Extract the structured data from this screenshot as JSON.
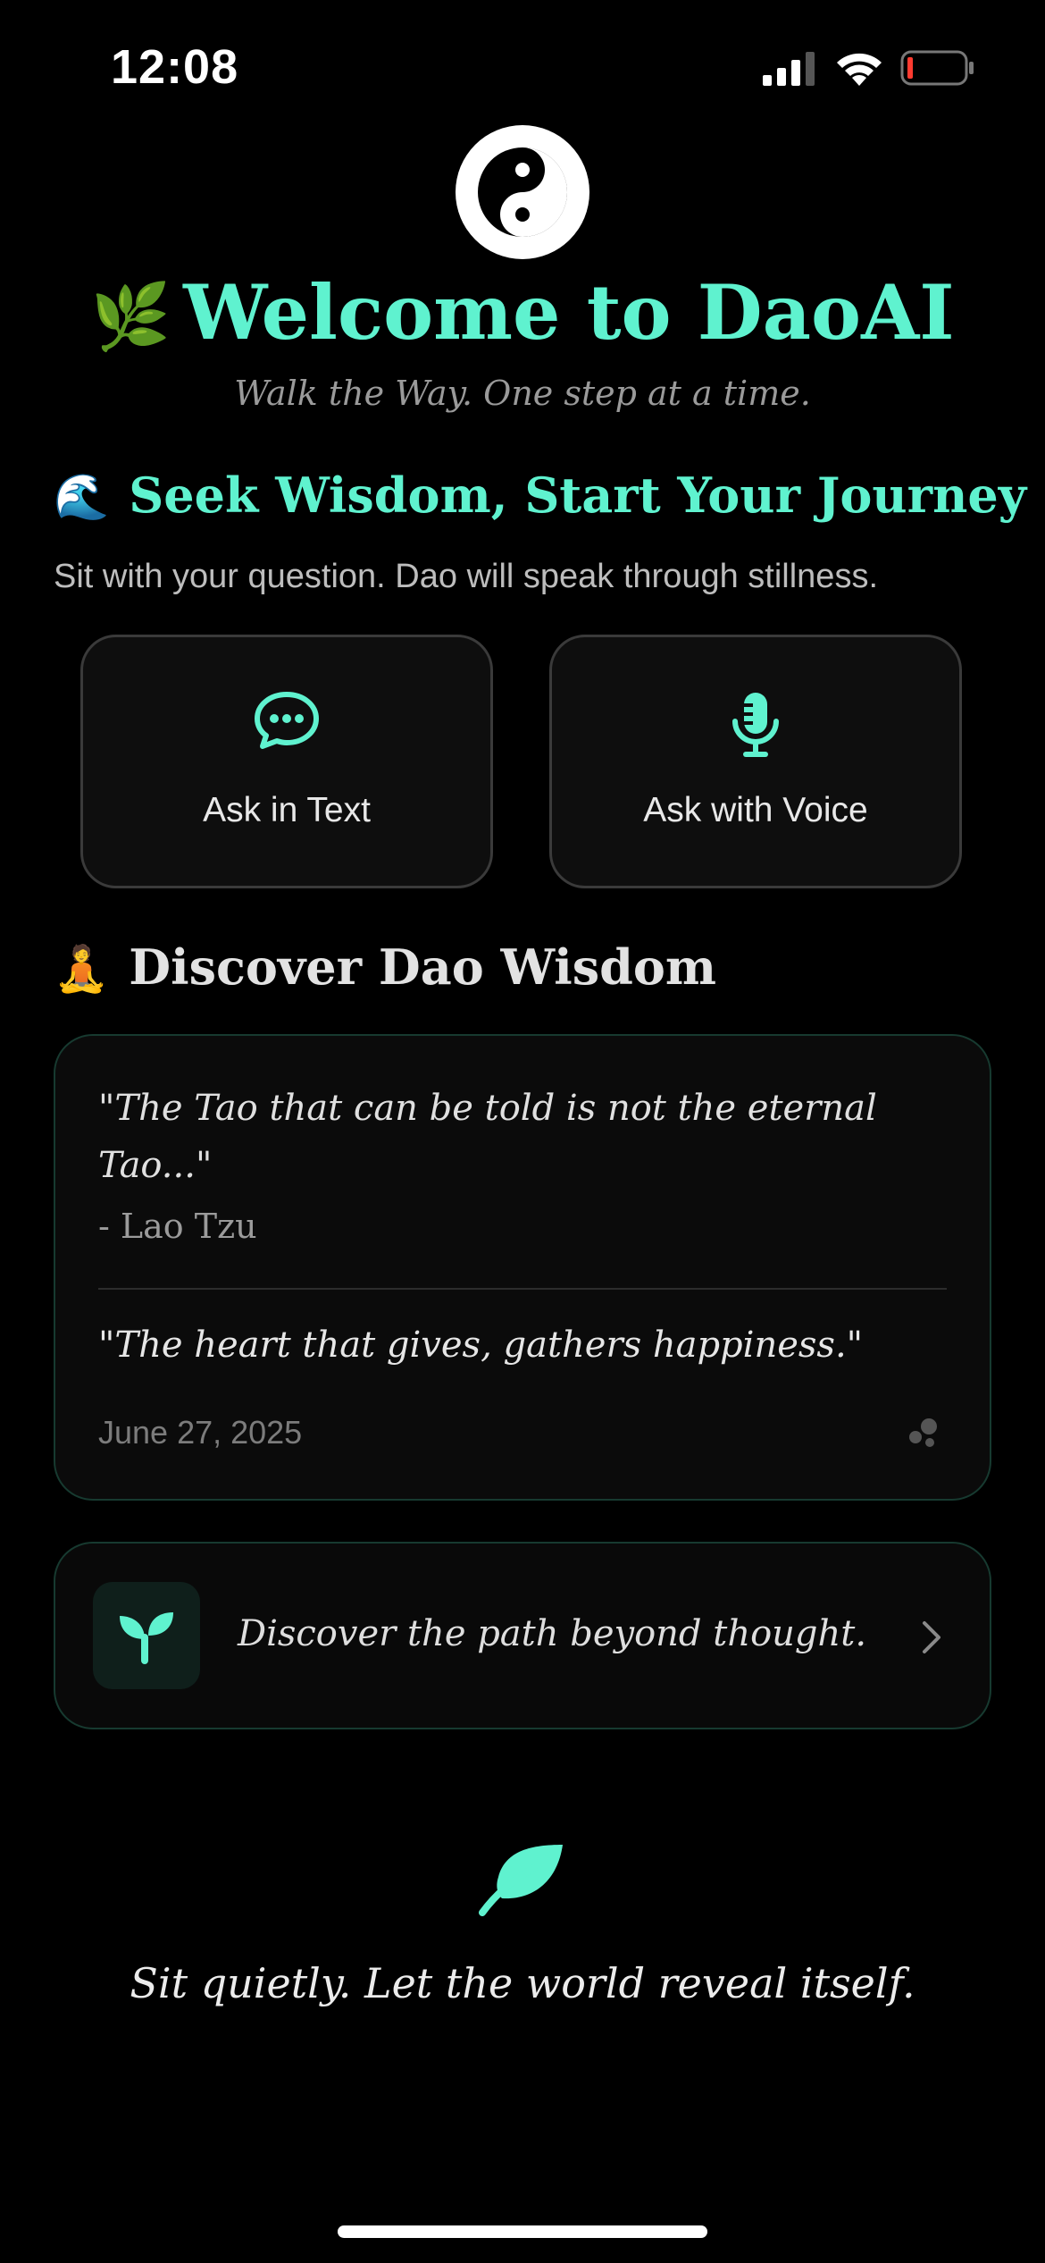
{
  "status_bar": {
    "time": "12:08"
  },
  "header": {
    "logo_icon": "yin-yang-icon",
    "title_emoji": "🌿",
    "title": "Welcome to DaoAI",
    "subtitle": "Walk the Way. One step at a time."
  },
  "seek": {
    "emoji": "🌊",
    "title": "Seek Wisdom, Start Your Journey",
    "description": "Sit with your question. Dao will speak through stillness.",
    "buttons": [
      {
        "label": "Ask in Text",
        "icon": "chat-bubble-icon"
      },
      {
        "label": "Ask with Voice",
        "icon": "microphone-icon"
      }
    ]
  },
  "discover": {
    "emoji": "🧘",
    "title": "Discover Dao Wisdom",
    "quote": "\"The Tao that can be told is not the eternal Tao...\"",
    "author": "- Lao Tzu",
    "daily_quote": "\"The heart that gives, gathers happiness.\"",
    "date": "June 27, 2025"
  },
  "path_card": {
    "text": "Discover the path beyond thought.",
    "icon": "sprout-icon"
  },
  "footer": {
    "icon": "leaf-icon",
    "text": "Sit quietly. Let the world reveal itself."
  },
  "colors": {
    "accent": "#5ff2cf",
    "background": "#000000",
    "card": "#0b0b0b"
  }
}
